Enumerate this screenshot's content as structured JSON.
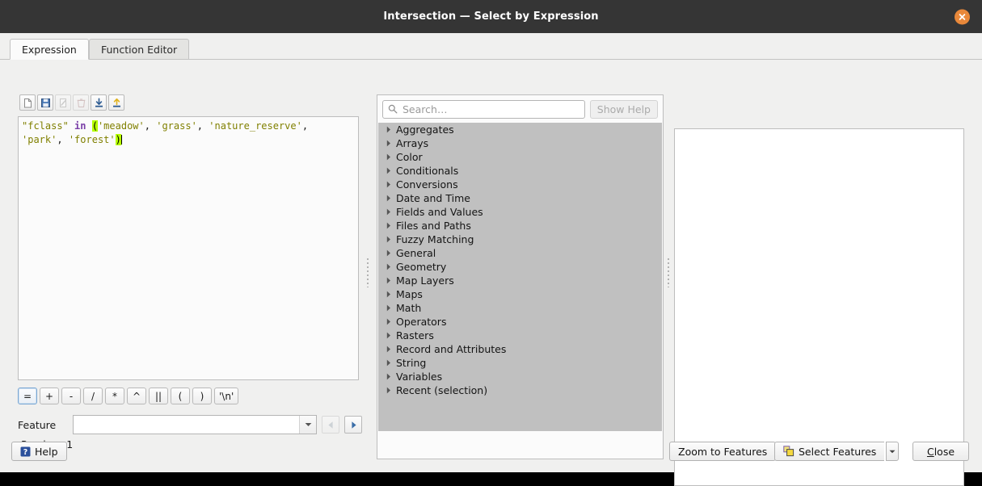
{
  "window": {
    "title": "Intersection — Select by Expression",
    "close_icon": "close-circle-icon"
  },
  "tabs": [
    {
      "label": "Expression",
      "active": true
    },
    {
      "label": "Function Editor",
      "active": false
    }
  ],
  "toolbar": {
    "buttons": [
      {
        "name": "new-expression",
        "icon": "new-file-icon",
        "enabled": true
      },
      {
        "name": "save-expression",
        "icon": "save-floppy-icon",
        "enabled": true
      },
      {
        "name": "edit-expression",
        "icon": "edit-pencil-icon",
        "enabled": false
      },
      {
        "name": "delete-expression",
        "icon": "trash-icon",
        "enabled": false
      },
      {
        "name": "import-expressions",
        "icon": "import-down-arrow-icon",
        "enabled": true
      },
      {
        "name": "export-expressions",
        "icon": "export-up-arrow-icon",
        "enabled": true
      }
    ]
  },
  "expression": {
    "full_text": "\"fclass\" in ('meadow', 'grass', 'nature_reserve', 'park', 'forest')",
    "tokens": [
      {
        "text": "\"fclass\"",
        "type": "field"
      },
      {
        "text": " ",
        "type": "plain"
      },
      {
        "text": "in",
        "type": "operator"
      },
      {
        "text": " ",
        "type": "plain"
      },
      {
        "text": "(",
        "type": "brace-highlight"
      },
      {
        "text": "'meadow'",
        "type": "string"
      },
      {
        "text": ",",
        "type": "plain"
      },
      {
        "text": " ",
        "type": "plain"
      },
      {
        "text": "'grass'",
        "type": "string"
      },
      {
        "text": ",",
        "type": "plain"
      },
      {
        "text": " ",
        "type": "plain"
      },
      {
        "text": "'nature_reserve'",
        "type": "string"
      },
      {
        "text": ",",
        "type": "plain"
      },
      {
        "text": "\n",
        "type": "newline"
      },
      {
        "text": "'park'",
        "type": "string"
      },
      {
        "text": ",",
        "type": "plain"
      },
      {
        "text": " ",
        "type": "plain"
      },
      {
        "text": "'forest'",
        "type": "string"
      },
      {
        "text": ")",
        "type": "brace-highlight"
      }
    ]
  },
  "operator_buttons": [
    {
      "label": "=",
      "focused": true
    },
    {
      "label": "+",
      "focused": false
    },
    {
      "label": "-",
      "focused": false
    },
    {
      "label": "/",
      "focused": false
    },
    {
      "label": "*",
      "focused": false
    },
    {
      "label": "^",
      "focused": false
    },
    {
      "label": "||",
      "focused": false
    },
    {
      "label": "(",
      "focused": false
    },
    {
      "label": ")",
      "focused": false
    },
    {
      "label": "'\\n'",
      "focused": false
    }
  ],
  "feature": {
    "label": "Feature",
    "value": "",
    "placeholder": "",
    "prev_enabled": false,
    "next_enabled": true
  },
  "preview": {
    "label": "Preview:",
    "value": "1"
  },
  "search": {
    "placeholder": "Search…",
    "value": "",
    "icon": "search-icon"
  },
  "show_help": {
    "label": "Show Help",
    "enabled": false
  },
  "function_tree": {
    "items": [
      {
        "label": "Aggregates",
        "expanded": false
      },
      {
        "label": "Arrays",
        "expanded": false
      },
      {
        "label": "Color",
        "expanded": false
      },
      {
        "label": "Conditionals",
        "expanded": false
      },
      {
        "label": "Conversions",
        "expanded": false
      },
      {
        "label": "Date and Time",
        "expanded": false
      },
      {
        "label": "Fields and Values",
        "expanded": false
      },
      {
        "label": "Files and Paths",
        "expanded": false
      },
      {
        "label": "Fuzzy Matching",
        "expanded": false
      },
      {
        "label": "General",
        "expanded": false
      },
      {
        "label": "Geometry",
        "expanded": false
      },
      {
        "label": "Map Layers",
        "expanded": false
      },
      {
        "label": "Maps",
        "expanded": false
      },
      {
        "label": "Math",
        "expanded": false
      },
      {
        "label": "Operators",
        "expanded": false
      },
      {
        "label": "Rasters",
        "expanded": false
      },
      {
        "label": "Record and Attributes",
        "expanded": false
      },
      {
        "label": "String",
        "expanded": false
      },
      {
        "label": "Variables",
        "expanded": false
      },
      {
        "label": "Recent (selection)",
        "expanded": false
      }
    ]
  },
  "help_panel": {
    "content": ""
  },
  "footer": {
    "help_label": "Help",
    "help_icon": "question-mark-icon",
    "zoom_to_features_label": "Zoom to Features",
    "select_features_label": "Select Features",
    "select_features_icon": "select-features-icon",
    "select_features_dropdown_icon": "chevron-down-icon",
    "close_label": "Close",
    "close_accelerator": "C"
  },
  "colors": {
    "titlebar_bg": "#353535",
    "close_button": "#e8883a",
    "dialog_bg": "#f0f0ef",
    "tree_bg": "#c0c0c0",
    "field_token": "#808000",
    "operator_token": "#7a3fa8",
    "string_token": "#808000",
    "brace_highlight": "#b6ff00"
  }
}
